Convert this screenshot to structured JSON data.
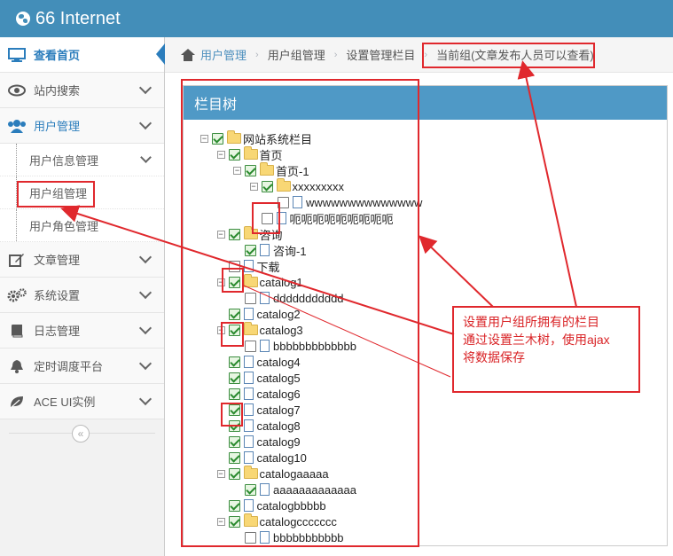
{
  "app": {
    "title": "66 Internet"
  },
  "sidebar": {
    "items": [
      {
        "label": "查看首页",
        "icon": "monitor-icon"
      },
      {
        "label": "站内搜索",
        "icon": "eye-icon"
      },
      {
        "label": "用户管理",
        "icon": "users-icon"
      },
      {
        "label": "用户信息管理"
      },
      {
        "label": "用户组管理"
      },
      {
        "label": "用户角色管理"
      },
      {
        "label": "文章管理",
        "icon": "edit-icon"
      },
      {
        "label": "系统设置",
        "icon": "cogs-icon"
      },
      {
        "label": "日志管理",
        "icon": "book-icon"
      },
      {
        "label": "定时调度平台",
        "icon": "bell-icon"
      },
      {
        "label": "ACE UI实例",
        "icon": "leaf-icon"
      }
    ],
    "collapse_glyph": "«"
  },
  "breadcrumb": {
    "items": [
      "用户管理",
      "用户组管理",
      "设置管理栏目",
      "当前组(文章发布人员可以查看)"
    ],
    "separator": "›"
  },
  "panel": {
    "title": "栏目树"
  },
  "tree": [
    {
      "label": "网站系统栏目",
      "type": "folder",
      "checked": true,
      "expander": "⊟"
    },
    {
      "label": "首页",
      "type": "folder",
      "checked": true,
      "expander": "⊟"
    },
    {
      "label": "首页-1",
      "type": "folder",
      "checked": true,
      "expander": "⊟"
    },
    {
      "label": "xxxxxxxxx",
      "type": "folder",
      "checked": true,
      "expander": "⊟"
    },
    {
      "label": "wwwwwwwwwwwwww",
      "type": "file",
      "checked": false
    },
    {
      "label": "呃呃呃呃呃呃呃呃呃",
      "type": "file",
      "checked": false
    },
    {
      "label": "咨询",
      "type": "folder",
      "checked": true,
      "expander": "⊟"
    },
    {
      "label": "咨询-1",
      "type": "file",
      "checked": true
    },
    {
      "label": "下载",
      "type": "file",
      "checked": false
    },
    {
      "label": "catalog1",
      "type": "folder",
      "checked": true,
      "expander": "⊟"
    },
    {
      "label": "ddddddddddd",
      "type": "file",
      "checked": false
    },
    {
      "label": "catalog2",
      "type": "file",
      "checked": true
    },
    {
      "label": "catalog3",
      "type": "folder",
      "checked": true,
      "expander": "⊟"
    },
    {
      "label": "bbbbbbbbbbbbb",
      "type": "file",
      "checked": false
    },
    {
      "label": "catalog4",
      "type": "file",
      "checked": true
    },
    {
      "label": "catalog5",
      "type": "file",
      "checked": true
    },
    {
      "label": "catalog6",
      "type": "file",
      "checked": true
    },
    {
      "label": "catalog7",
      "type": "file",
      "checked": true
    },
    {
      "label": "catalog8",
      "type": "file",
      "checked": true
    },
    {
      "label": "catalog9",
      "type": "file",
      "checked": true
    },
    {
      "label": "catalog10",
      "type": "file",
      "checked": true
    },
    {
      "label": "catalogaaaaa",
      "type": "folder",
      "checked": true,
      "expander": "⊟"
    },
    {
      "label": "aaaaaaaaaaaaa",
      "type": "file",
      "checked": true
    },
    {
      "label": "catalogbbbbb",
      "type": "file",
      "checked": true
    },
    {
      "label": "catalogccccccc",
      "type": "folder",
      "checked": true,
      "expander": "⊟"
    },
    {
      "label": "bbbbbbbbbbb",
      "type": "file",
      "checked": false
    }
  ],
  "annotation": {
    "lines": [
      "设置用户组所拥有的栏目",
      "通过设置兰木树，使用ajax",
      "将数据保存"
    ],
    "color": "#e0282d"
  },
  "colors": {
    "navbar": "#438eb9",
    "panel_header": "#4f99c6",
    "link": "#4c8fbd"
  }
}
